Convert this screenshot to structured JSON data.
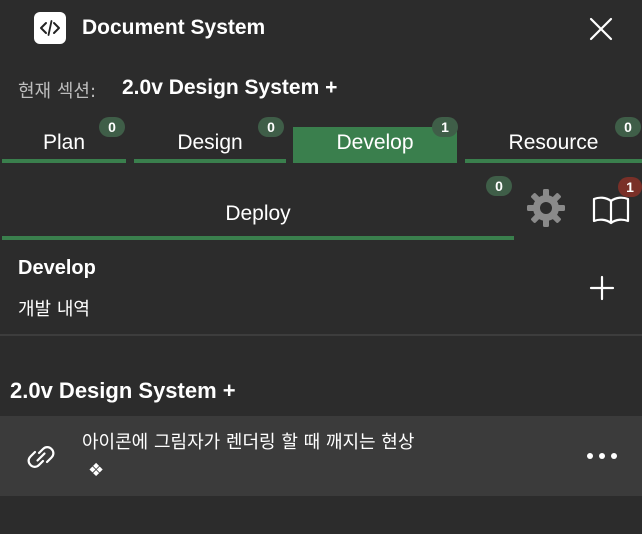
{
  "header": {
    "title": "Document System",
    "app_icon": "code-icon",
    "close_icon": "close-icon"
  },
  "current_section": {
    "label": "현재 섹션:",
    "value": "2.0v Design System +"
  },
  "tabs": [
    {
      "label": "Plan",
      "count": "0",
      "active": false
    },
    {
      "label": "Design",
      "count": "0",
      "active": false
    },
    {
      "label": "Develop",
      "count": "1",
      "active": true
    },
    {
      "label": "Resource",
      "count": "0",
      "active": false
    },
    {
      "label": "Deploy",
      "count": "0",
      "active": false
    }
  ],
  "toolbar": {
    "settings_icon": "gear-icon",
    "book_icon": "book-icon",
    "book_count": "1"
  },
  "section": {
    "title": "Develop",
    "subtitle": "개발 내역",
    "add_icon": "plus-icon"
  },
  "group": {
    "title": "2.0v Design System +",
    "items": [
      {
        "text": "아이콘에 그림자가 렌더링 할 때 깨지는 현상",
        "sub": "❖",
        "icon": "link-icon",
        "more_icon": "more-icon"
      }
    ]
  },
  "colors": {
    "background": "#2c2c2c",
    "accent": "#3a7f4d",
    "badge": "#3f5e48",
    "badge_alert": "#7a3028",
    "row_bg": "#3b3b3b"
  }
}
